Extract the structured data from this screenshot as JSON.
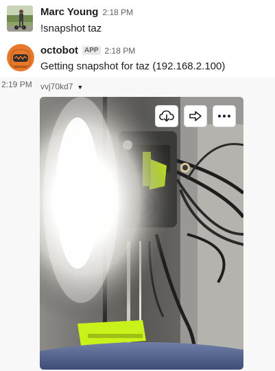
{
  "messages": [
    {
      "author": "Marc Young",
      "time": "2:18 PM",
      "text": "!snapshot taz",
      "avatar_icon": "user-photo-avatar"
    },
    {
      "author": "octobot",
      "badge": "APP",
      "time": "2:18 PM",
      "text": "Getting snapshot for taz (192.168.2.100)",
      "avatar_icon": "octobot-avatar"
    }
  ],
  "attachment": {
    "time": "2:19 PM",
    "file_name": "vvj70kd7",
    "caret_icon": "caret-down-icon",
    "actions": [
      {
        "name": "download",
        "icon": "cloud-download-icon"
      },
      {
        "name": "share",
        "icon": "share-arrow-icon"
      },
      {
        "name": "more",
        "icon": "more-actions-icon"
      }
    ]
  },
  "colors": {
    "octobot_orange": "#e8782a",
    "printer_green": "#c8f21a",
    "hover_bg": "#f8f8f8"
  }
}
